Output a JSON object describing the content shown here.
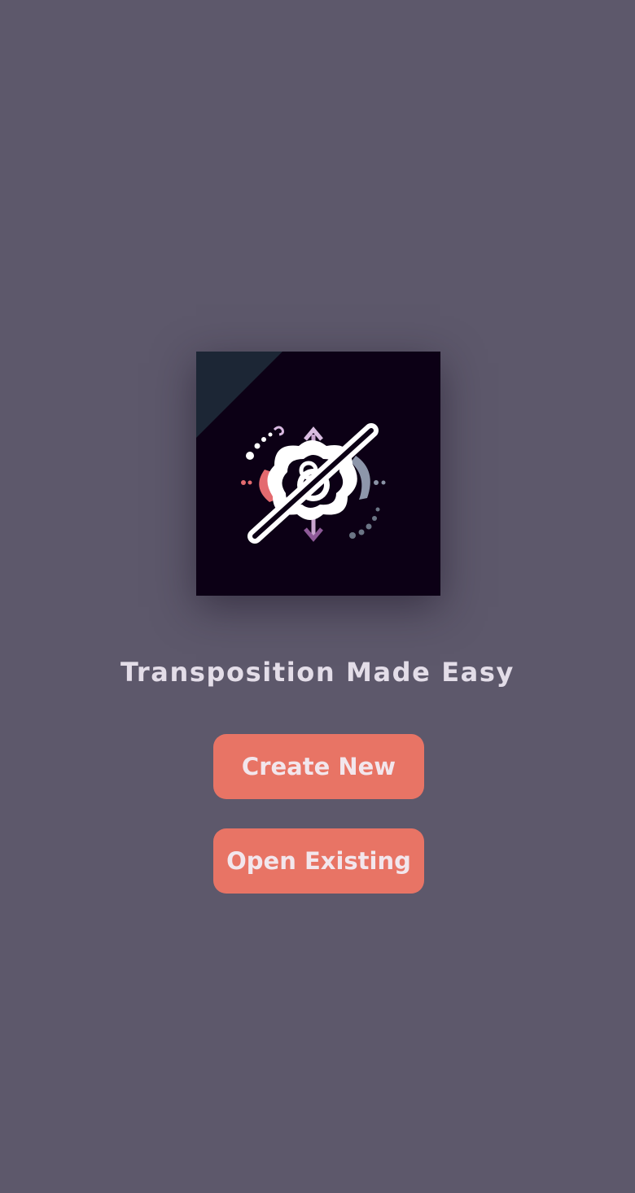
{
  "welcome": {
    "logo_icon": "transposition-logo-icon",
    "tagline": "Transposition Made Easy",
    "buttons": {
      "create_new": "Create New",
      "open_existing": "Open Existing"
    }
  },
  "colors": {
    "background": "#5d586b",
    "button": "#e87465",
    "button_text": "#f2e6ec",
    "tagline_text": "#e3dde8",
    "logo_background": "#0c0015"
  }
}
